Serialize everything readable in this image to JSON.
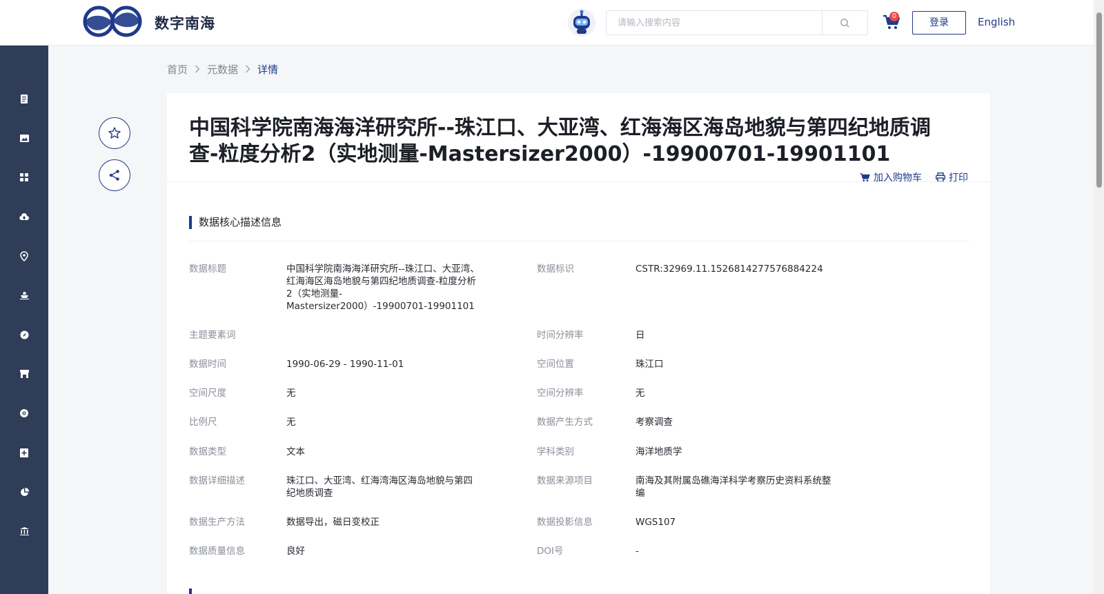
{
  "header": {
    "brand": "数字南海",
    "search_placeholder": "请输入搜索内容",
    "cart_count": "0",
    "login_label": "登录",
    "language_label": "English"
  },
  "sidebar": {
    "icons": [
      "document-icon",
      "image-icon",
      "grid-icon",
      "cloud-upload-icon",
      "location-pin-icon",
      "ship-icon",
      "compass-icon",
      "store-icon",
      "globe-icon",
      "add-box-icon",
      "pie-chart-icon",
      "building-icon"
    ]
  },
  "breadcrumb": {
    "items": [
      "首页",
      "元数据",
      "详情"
    ]
  },
  "detail": {
    "title": "中国科学院南海海洋研究所--珠江口、大亚湾、红海海区海岛地貌与第四纪地质调查-粒度分析2（实地测量-Mastersizer2000）-19900701-19901101",
    "add_to_cart": "加入购物车",
    "print": "打印",
    "section_title": "数据核心描述信息",
    "left_fields": [
      {
        "label": "数据标题",
        "value": "中国科学院南海海洋研究所--珠江口、大亚湾、红海海区海岛地貌与第四纪地质调查-粒度分析2（实地测量-Mastersizer2000）-19900701-19901101"
      },
      {
        "label": "主题要素词",
        "value": ""
      },
      {
        "label": "数据时间",
        "value": "1990-06-29 - 1990-11-01"
      },
      {
        "label": "空间尺度",
        "value": "无"
      },
      {
        "label": "比例尺",
        "value": "无"
      },
      {
        "label": "数据类型",
        "value": "文本"
      },
      {
        "label": "数据详细描述",
        "value": "珠江口、大亚湾、红海湾海区海岛地貌与第四纪地质调查"
      },
      {
        "label": "数据生产方法",
        "value": "数据导出，磁日变校正"
      },
      {
        "label": "数据质量信息",
        "value": "良好"
      }
    ],
    "right_fields": [
      {
        "label": "数据标识",
        "value": "CSTR:32969.11.1526814277576884224"
      },
      {
        "label": "时间分辨率",
        "value": "日"
      },
      {
        "label": "空间位置",
        "value": "珠江口"
      },
      {
        "label": "空间分辨率",
        "value": "无"
      },
      {
        "label": "数据产生方式",
        "value": "考察调查"
      },
      {
        "label": "学科类别",
        "value": "海洋地质学"
      },
      {
        "label": "数据来源项目",
        "value": "南海及其附属岛礁海洋科学考察历史资料系统整编"
      },
      {
        "label": "数据投影信息",
        "value": "WGS107"
      },
      {
        "label": "DOI号",
        "value": "-"
      }
    ]
  },
  "colors": {
    "accent": "#1f3a8a",
    "sidebar": "#2f3d58",
    "badge": "#e84a4a"
  }
}
